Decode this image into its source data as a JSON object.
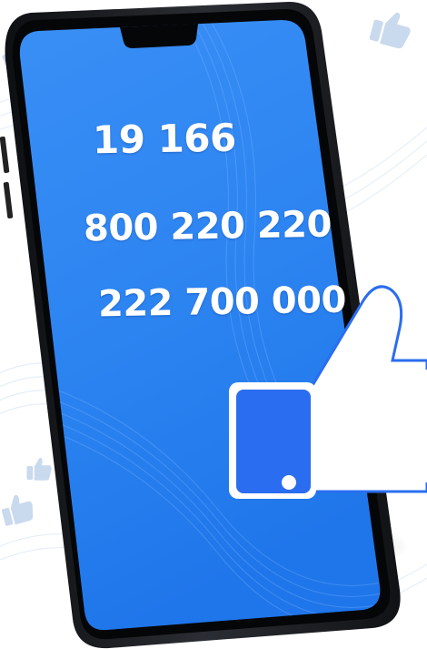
{
  "phone_numbers": [
    "19 166",
    "800 220 220",
    "222 700 000"
  ],
  "colors": {
    "screen_blue": "#2f86f2",
    "screen_blue_dark": "#1a6fe6",
    "phone_frame": "#1b1d22",
    "thumb_blue": "#2a6df0",
    "thumb_outline": "#ffffff",
    "background": "#ffffff",
    "pattern": "#dde8f4"
  },
  "icons": [
    "phone-device",
    "thumbs-up-icon",
    "background-like-icon"
  ]
}
